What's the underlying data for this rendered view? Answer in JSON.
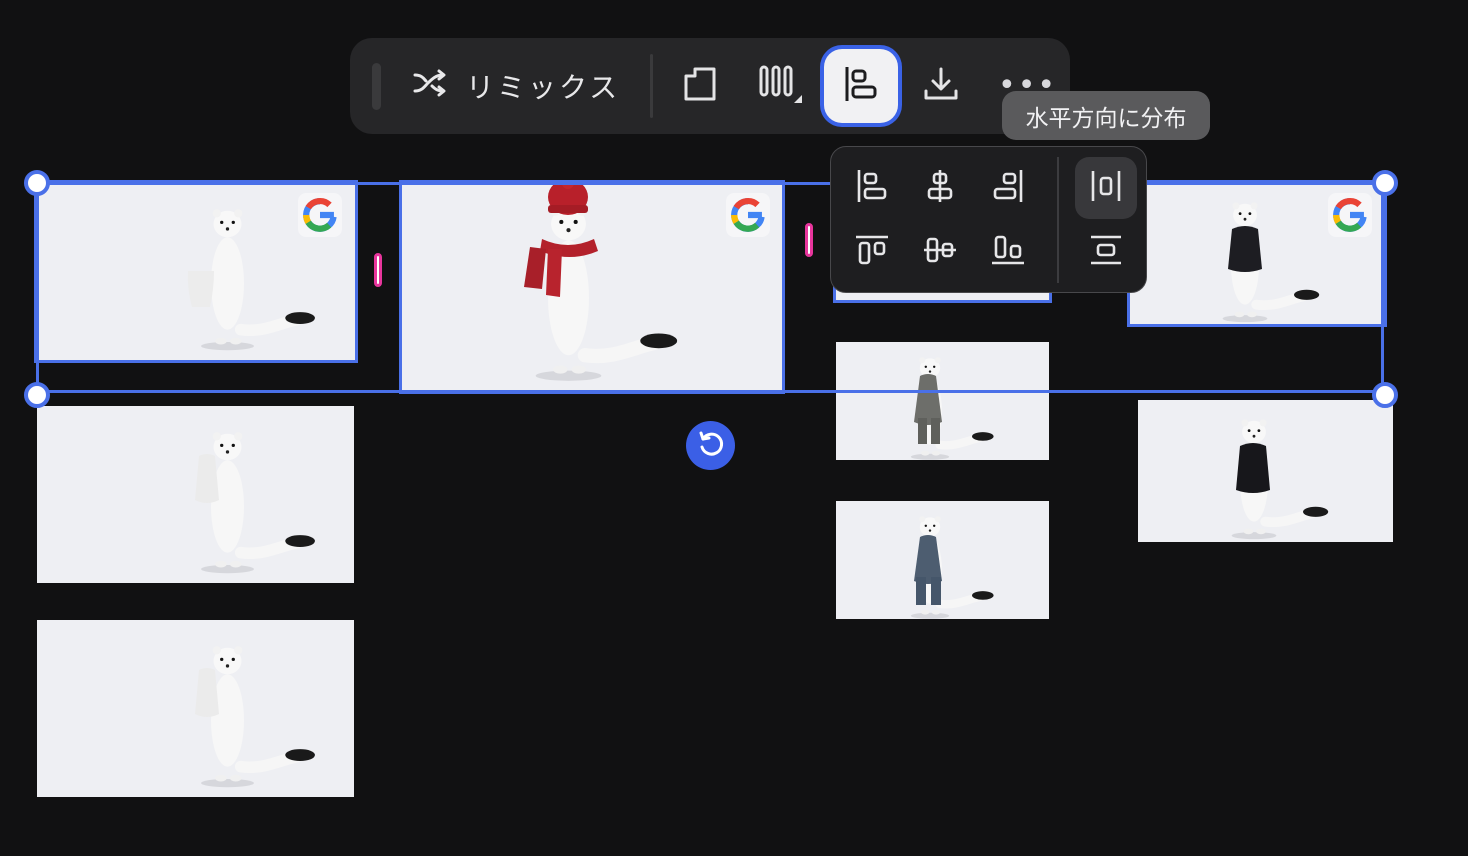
{
  "toolbar": {
    "remix_label": "リミックス",
    "buttons": [
      "crop-icon",
      "columns-layout-icon",
      "align-icon",
      "download-icon",
      "more-icon"
    ],
    "more_label": "•••"
  },
  "tooltip": {
    "text": "水平方向に分布"
  },
  "align_menu": {
    "items": [
      "align-left-icon",
      "align-horizontal-center-icon",
      "align-right-icon",
      "align-top-icon",
      "align-vertical-center-icon",
      "align-bottom-icon",
      "distribute-horizontal-icon",
      "distribute-vertical-icon"
    ],
    "highlighted": "distribute-horizontal-icon"
  },
  "colors": {
    "selection": "#4a70e8",
    "gap_indicator": "#e8359c",
    "canvas_bg": "#111112",
    "toolbar_bg": "#262628"
  },
  "images": [
    {
      "name": "ermine-white-sweater",
      "selected": true,
      "badge": "google-g-icon"
    },
    {
      "name": "ermine-red-hat-scarf",
      "selected": true,
      "badge": "google-g-icon"
    },
    {
      "name": "ermine-behind-popover",
      "selected": true
    },
    {
      "name": "ermine-black-sweater",
      "selected": true,
      "badge": "google-g-icon"
    },
    {
      "name": "ermine-white-sweater-2",
      "selected": false
    },
    {
      "name": "ermine-white-sweater-3",
      "selected": false
    },
    {
      "name": "ermine-gray-jacket",
      "selected": false
    },
    {
      "name": "ermine-denim-overalls",
      "selected": false
    },
    {
      "name": "ermine-black-sweater-2",
      "selected": false
    }
  ]
}
